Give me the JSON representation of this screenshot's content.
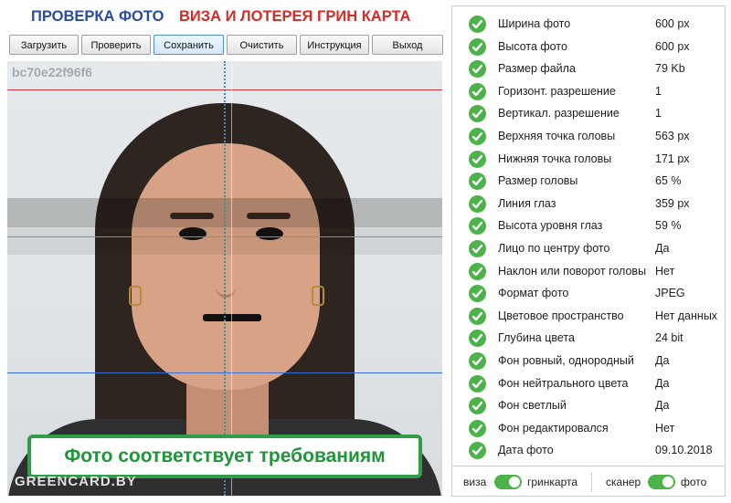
{
  "header": {
    "title_left": "ПРОВЕРКА ФОТО",
    "title_right": "ВИЗА И ЛОТЕРЕЯ ГРИН КАРТА"
  },
  "toolbar": {
    "load": "Загрузить",
    "check": "Проверить",
    "save": "Сохранить",
    "clear": "Очистить",
    "instruction": "Инструкция",
    "exit": "Выход"
  },
  "photo": {
    "id": "bc70e22f96f6",
    "status": "Фото соответствует требованиям",
    "watermark": "GREENCARD.BY"
  },
  "colors": {
    "accent_green": "#4cb24a",
    "title_blue": "#2a4c9c",
    "title_red": "#d02c28",
    "line_red": "#d0383a",
    "line_green": "#33c35f",
    "line_blue": "#3a6fd0"
  },
  "checks": [
    {
      "label": "Ширина фото",
      "value": "600 px"
    },
    {
      "label": "Высота фото",
      "value": "600 px"
    },
    {
      "label": "Размер файла",
      "value": "79 Kb"
    },
    {
      "label": "Горизонт. разрешение",
      "value": "1"
    },
    {
      "label": "Вертикал. разрешение",
      "value": "1"
    },
    {
      "label": "Верхняя точка головы",
      "value": "563 px"
    },
    {
      "label": "Нижняя точка головы",
      "value": "171 px"
    },
    {
      "label": "Размер головы",
      "value": "65 %"
    },
    {
      "label": "Линия глаз",
      "value": "359 px"
    },
    {
      "label": "Высота уровня глаз",
      "value": "59 %"
    },
    {
      "label": "Лицо по центру фото",
      "value": "Да"
    },
    {
      "label": "Наклон или поворот головы",
      "value": "Нет"
    },
    {
      "label": "Формат фото",
      "value": "JPEG"
    },
    {
      "label": "Цветовое пространство",
      "value": "Нет данных"
    },
    {
      "label": "Глубина цвета",
      "value": "24 bit"
    },
    {
      "label": "Фон ровный, однородный",
      "value": "Да"
    },
    {
      "label": "Фон нейтрального цвета",
      "value": "Да"
    },
    {
      "label": "Фон светлый",
      "value": "Да"
    },
    {
      "label": "Фон редактировался",
      "value": "Нет"
    },
    {
      "label": "Дата фото",
      "value": "09.10.2018"
    }
  ],
  "footer": {
    "visa": "виза",
    "greencard": "гринкарта",
    "scanner": "сканер",
    "photo": "фото"
  }
}
